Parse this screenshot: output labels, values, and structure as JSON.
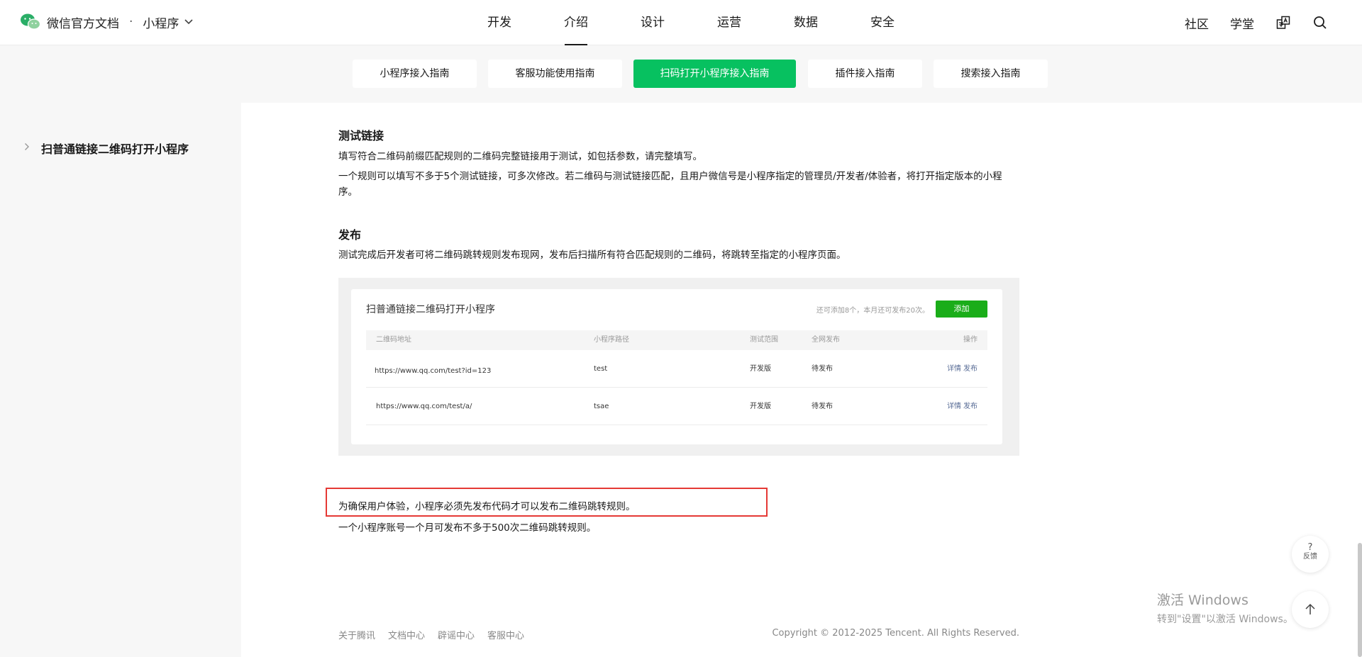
{
  "brand": {
    "name": "微信官方文档",
    "separator": "·",
    "section": "小程序"
  },
  "nav": {
    "items": [
      "开发",
      "介绍",
      "设计",
      "运营",
      "数据",
      "安全"
    ],
    "active": "介绍"
  },
  "right_nav": {
    "community": "社区",
    "academy": "学堂"
  },
  "subnav": {
    "tabs": [
      "小程序接入指南",
      "客服功能使用指南",
      "扫码打开小程序接入指南",
      "插件接入指南",
      "搜索接入指南"
    ],
    "active": "扫码打开小程序接入指南"
  },
  "sidebar": {
    "item": "扫普通链接二维码打开小程序"
  },
  "content": {
    "test_heading": "测试链接",
    "test_p1": "填写符合二维码前缀匹配规则的二维码完整链接用于测试，如包括参数，请完整填写。",
    "test_p2": "一个规则可以填写不多于5个测试链接，可多次修改。若二维码与测试链接匹配，且用户微信号是小程序指定的管理员/开发者/体验者，将打开指定版本的小程序。",
    "publish_heading": "发布",
    "publish_p1": "测试完成后开发者可将二维码跳转规则发布现网，发布后扫描所有符合匹配规则的二维码，将跳转至指定的小程序页面。",
    "notice_line1": "为确保用户体验，小程序必须先发布代码才可以发布二维码跳转规则。",
    "notice_line2": "一个小程序账号一个月可发布不多于500次二维码跳转规则。"
  },
  "figure": {
    "title": "扫普通链接二维码打开小程序",
    "hint": "还可添加8个，本月还可发布20次。",
    "add_button": "添加",
    "columns": [
      "二维码地址",
      "小程序路径",
      "测试范围",
      "全网发布",
      "操作"
    ],
    "rows": [
      {
        "url": "https://www.qq.com/test?id=123",
        "path": "test",
        "scope": "开发版",
        "status": "待发布",
        "op_detail": "详情",
        "op_publish": "发布"
      },
      {
        "url": "https://www.qq.com/test/a/",
        "path": "tsae",
        "scope": "开发版",
        "status": "待发布",
        "op_detail": "详情",
        "op_publish": "发布"
      }
    ]
  },
  "footer": {
    "links": [
      "关于腾讯",
      "文档中心",
      "辟谣中心",
      "客服中心"
    ],
    "copyright": "Copyright © 2012-2025 Tencent. All Rights Reserved."
  },
  "floating": {
    "feedback_symbol": "?",
    "feedback_label": "反馈"
  },
  "windows": {
    "line1": "激活 Windows",
    "line2": "转到\"设置\"以激活 Windows。"
  },
  "colors": {
    "accent": "#07c160",
    "add_button": "#1aad19",
    "link": "#576b95",
    "highlight_border": "#e53935"
  }
}
